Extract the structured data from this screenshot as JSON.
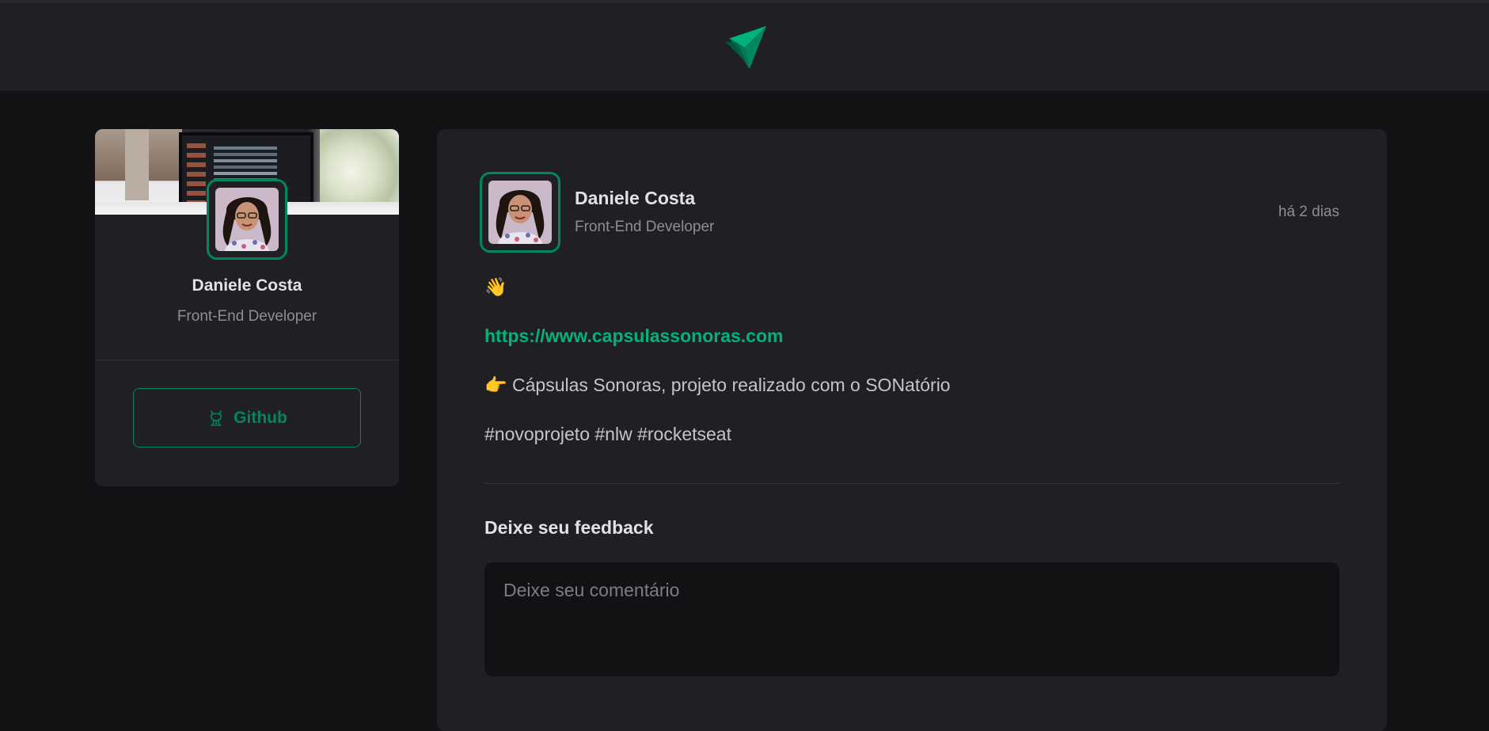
{
  "header": {
    "logo_icon": "paper-plane-logo-icon",
    "accent_color": "#00875f"
  },
  "sidebar": {
    "name": "Daniele Costa",
    "role": "Front-End Developer",
    "github_button": {
      "icon": "github-icon",
      "label": "Github"
    }
  },
  "post": {
    "author": "Daniele Costa",
    "role": "Front-End Developer",
    "time": "há 2 dias",
    "content": {
      "wave": "👋",
      "link": "https://www.capsulassonoras.com",
      "description": "👉 Cápsulas Sonoras, projeto realizado com o SONatório",
      "tags": "#novoprojeto #nlw #rocketseat"
    },
    "feedback": {
      "title": "Deixe seu feedback",
      "placeholder": "Deixe seu comentário",
      "value": ""
    }
  }
}
